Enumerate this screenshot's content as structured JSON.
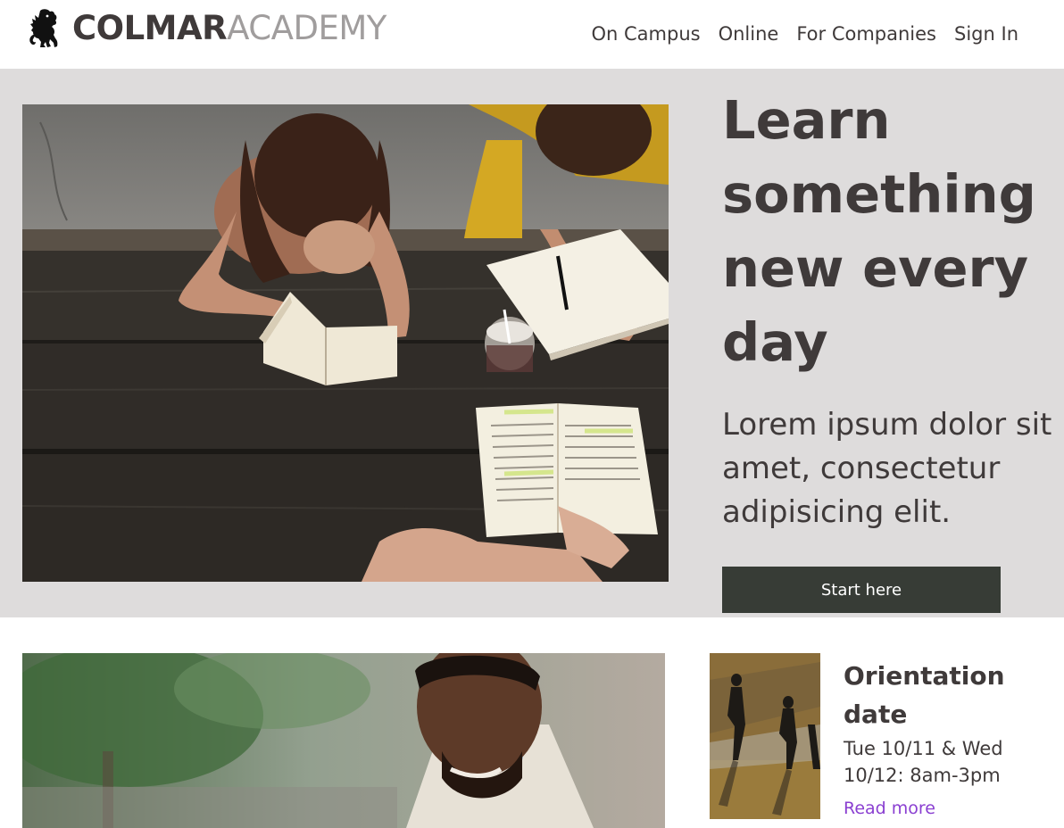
{
  "header": {
    "logo_strong": "COLMAR",
    "logo_light": "ACADEMY",
    "logo_icon": "lion-rampant-icon",
    "nav": [
      {
        "label": "On Campus"
      },
      {
        "label": "Online"
      },
      {
        "label": "For Companies"
      },
      {
        "label": "Sign In"
      }
    ]
  },
  "hero": {
    "title": "Learn something new every day",
    "subtitle": "Lorem ipsum dolor sit amet, consectetur adipisicing elit.",
    "cta_label": "Start here",
    "image": "students-studying-at-picnic-table"
  },
  "event": {
    "title": "Orientation date",
    "date": "Tue 10/11 & Wed 10/12: 8am-3pm",
    "link_label": "Read more",
    "thumbnail": "people-walking-on-grass"
  },
  "feature": {
    "image": "smiling-man-outdoors"
  },
  "colors": {
    "text": "#3f3a3a",
    "hero_bg": "#dedcdc",
    "button_bg": "#373c36",
    "link": "#8a3fd1",
    "logo_light": "#a09d9d"
  }
}
